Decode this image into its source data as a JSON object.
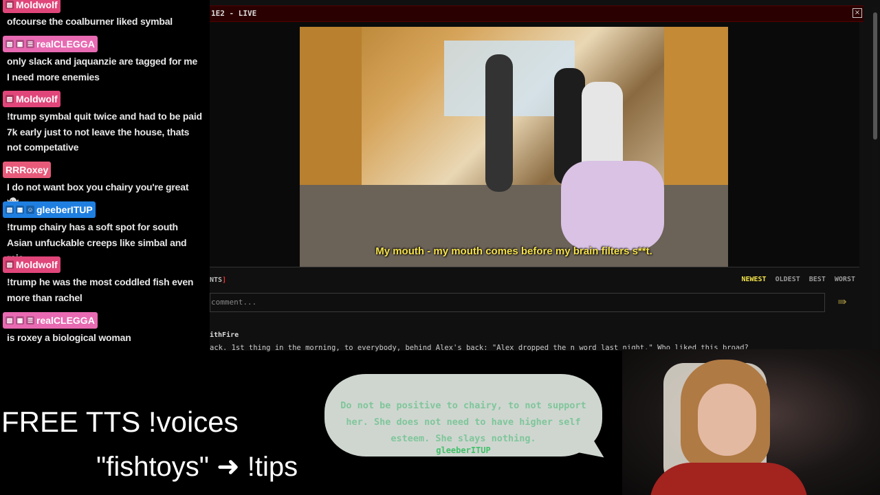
{
  "chat": {
    "messages": [
      {
        "user": "Moldwolf",
        "color": "#e0467a",
        "badges": [
          "▧"
        ],
        "text": "ofcourse the coalburner liked symbal"
      },
      {
        "user": "realCLEGGA",
        "color": "#e86ab2",
        "badges": [
          "▧",
          "▦",
          "☰"
        ],
        "text": "only slack and jaquanzie are tagged for me I need more enemies"
      },
      {
        "user": "Moldwolf",
        "color": "#e0467a",
        "badges": [
          "▧"
        ],
        "text": "!trump symbal quit twice and had to be paid 7k early just to not leave the house, thats not competative"
      },
      {
        "user": "RRRoxey",
        "color": "#e85a7a",
        "badges": [],
        "text": "I do not want box you chairy you're great 👻"
      },
      {
        "user": "gleeberITUP",
        "color": "#1f7fe0",
        "badges": [
          "▧",
          "▦",
          "☺"
        ],
        "text": "!trump chairy has a soft spot for south Asian unfuckable creeps like simbal and raja"
      },
      {
        "user": "Moldwolf",
        "color": "#e0467a",
        "badges": [
          "▧"
        ],
        "text": "!trump he was the most coddled fish even more than rachel"
      },
      {
        "user": "realCLEGGA",
        "color": "#e86ab2",
        "badges": [
          "▧",
          "▦",
          "☰"
        ],
        "text": "is roxey a biological woman"
      }
    ]
  },
  "window": {
    "title": "1E2 - LIVE",
    "close_icon": "×",
    "subtitle": "My mouth - my mouth comes before my brain filters s**t.",
    "comments_label": "NTS",
    "comments_bracket": "]",
    "sort_options": [
      "NEWEST",
      "OLDEST",
      "BEST",
      "WORST"
    ],
    "comment_placeholder": "comment...",
    "send_icon": "⇛",
    "comment_user": "ithFire",
    "comment_text": "ack. 1st thing in the morning, to everybody, behind Alex's back: \"Alex dropped the n word last night.\" Who liked this broad?"
  },
  "overlay": {
    "tts_line1": "FREE TTS !voices",
    "tts_line2": "\"fishtoys\" ➜ !tips",
    "bubble_text": "Do not be positive to chairy, to not support her. She does not need to have higher self esteem. She slays nothing.",
    "bubble_name": "gleeberITUP"
  }
}
